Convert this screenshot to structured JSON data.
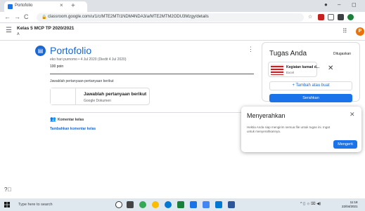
{
  "browser": {
    "tab_title": "Portofolio",
    "tab_close": "×",
    "new_tab": "+",
    "url": "classroom.google.com/u/1/c/MTE2MTI1NDM4NDA3/a/MTE2MTM2ODU3Mzgy/details",
    "back": "←",
    "forward": "→",
    "reload": "C",
    "lock_icon": "lock-icon",
    "star": "☆",
    "minimize": "–",
    "maximize": "◻"
  },
  "appbar": {
    "class_title": "Kelas 5 MCP TP 2020/2021",
    "class_section": "A",
    "apps_icon": "⠿",
    "avatar_letter": "P"
  },
  "assignment": {
    "title": "Portofolio",
    "meta": "eko hari purnomo • 4 Jul 2020 (Diedit 4 Jul 2020)",
    "points": "100 poin",
    "instruction": "Jawablah pertanyaan-pertanyaan berikut",
    "attachment": {
      "name": "Jawablah pertanyaan berikut",
      "type": "Google Dokumen"
    },
    "class_comments_label": "Komentar kelas",
    "add_class_comment": "Tambahkan komentar kelas"
  },
  "your_work": {
    "title": "Tugas Anda",
    "status": "Ditugaskan",
    "file_name": "Kegiatan kamad d...",
    "file_type": "Excel",
    "remove": "✕",
    "add_or_create": "+ Tambah atau buat",
    "submit": "Serahkan"
  },
  "dialog": {
    "title": "Menyerahkan",
    "close": "✕",
    "body": "Hektia Anda siap mengirim semua file untuk tugas ini. Ingat untuk menyerahkannya.",
    "button": "Mengerti"
  },
  "taskbar": {
    "search_placeholder": "Type here to search",
    "tray": "^ ▯ ☼ ⌧ ◀)",
    "time": "11:18",
    "date": "22/04/2021"
  },
  "colors": {
    "accent": "#1967d2",
    "button": "#1a73e8",
    "avatar": "#e8710a"
  }
}
